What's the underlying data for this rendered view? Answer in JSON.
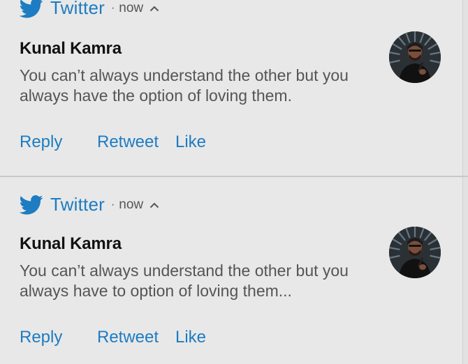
{
  "colors": {
    "twitter_blue": "#1d7cc2",
    "card_background": "#e8e8e8",
    "body_text": "#555555",
    "title_text": "#111111"
  },
  "notifications": [
    {
      "app_icon": "twitter-bird-icon",
      "app_name": "Twitter",
      "separator": "·",
      "time": "now",
      "expand_icon": "chevron-up-icon",
      "title": "Kunal Kamra",
      "body": "You can’t always understand the other but you always have the option of loving them.",
      "avatar": "user-avatar",
      "actions": [
        "Reply",
        "Retweet",
        "Like"
      ]
    },
    {
      "app_icon": "twitter-bird-icon",
      "app_name": "Twitter",
      "separator": "·",
      "time": "now",
      "expand_icon": "chevron-up-icon",
      "title": "Kunal Kamra",
      "body": "You can’t always understand the other but you always have to option of loving them...",
      "avatar": "user-avatar",
      "actions": [
        "Reply",
        "Retweet",
        "Like"
      ]
    }
  ]
}
